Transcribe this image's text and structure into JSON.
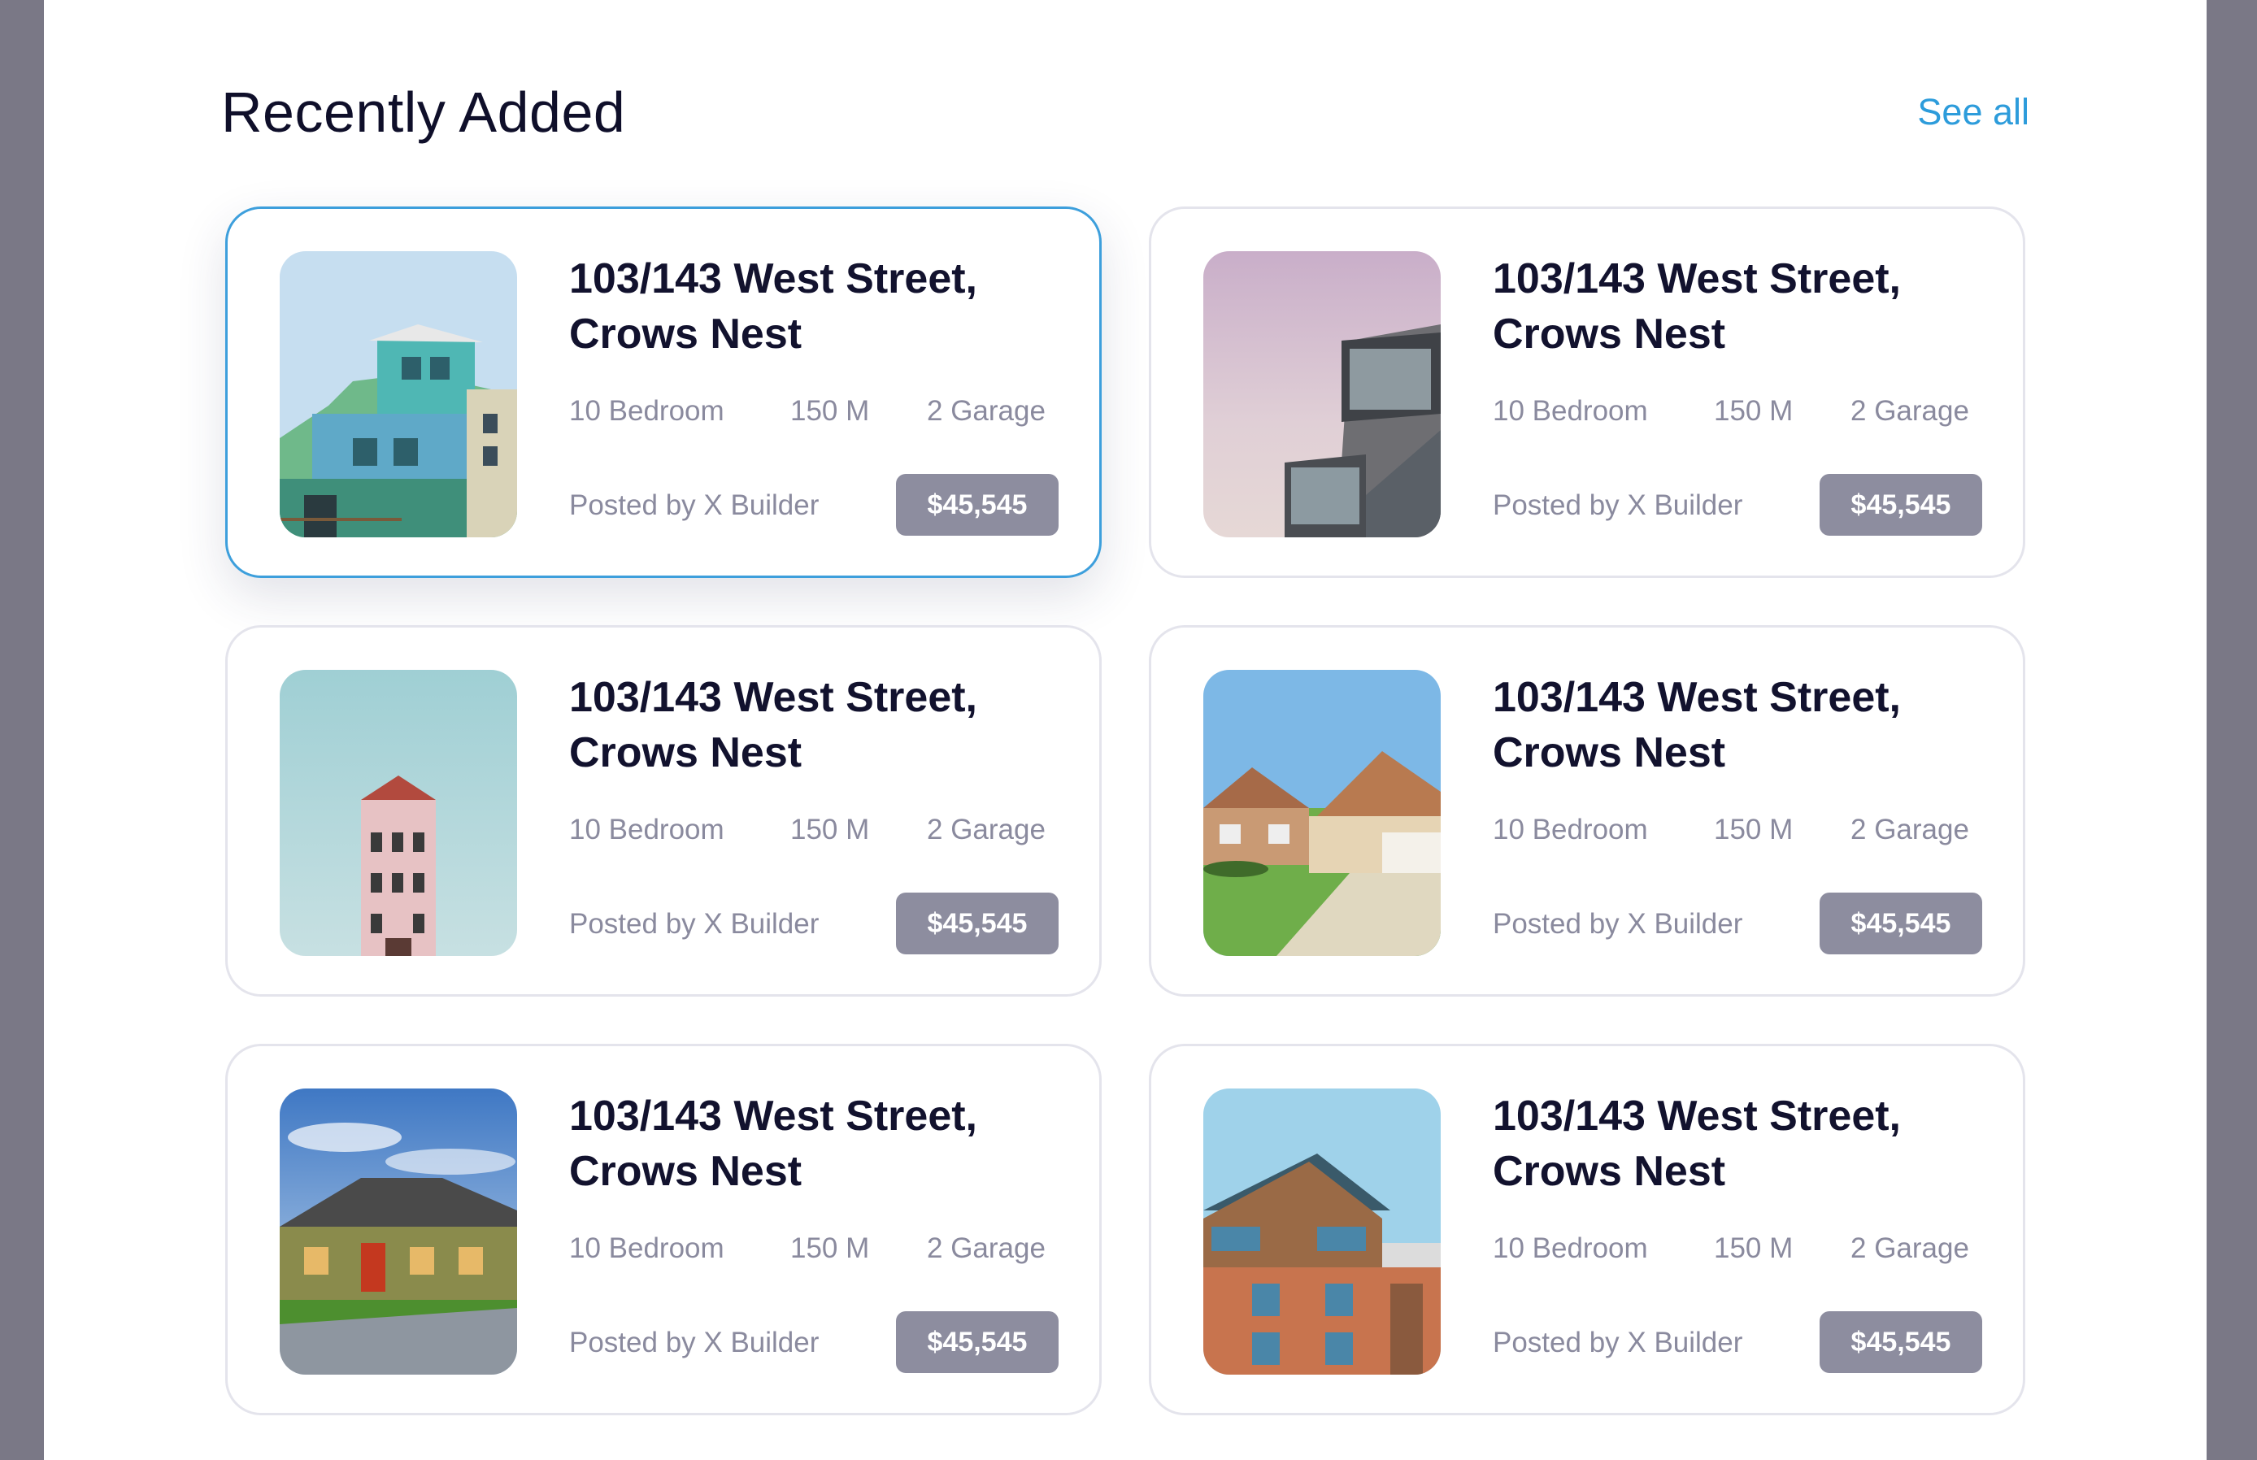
{
  "header": {
    "title": "Recently Added",
    "see_all": "See all"
  },
  "colors": {
    "accent": "#2d9cdb",
    "price_badge": "#8d8d9f",
    "title_text": "#12122e",
    "muted_text": "#8a8a9e"
  },
  "listings": [
    {
      "address": "103/143 West Street, Crows Nest",
      "bedrooms": "10 Bedroom",
      "area": "150 M",
      "garage": "2 Garage",
      "posted_by": "Posted by X Builder",
      "price": "$45,545",
      "image": "colorful-house-photo",
      "active": true
    },
    {
      "address": "103/143 West Street, Crows Nest",
      "bedrooms": "10 Bedroom",
      "area": "150 M",
      "garage": "2 Garage",
      "posted_by": "Posted by X Builder",
      "price": "$45,545",
      "image": "modern-glass-building-photo",
      "active": false
    },
    {
      "address": "103/143 West Street, Crows Nest",
      "bedrooms": "10 Bedroom",
      "area": "150 M",
      "garage": "2 Garage",
      "posted_by": "Posted by X Builder",
      "price": "$45,545",
      "image": "narrow-pink-tower-house-photo",
      "active": false
    },
    {
      "address": "103/143 West Street, Crows Nest",
      "bedrooms": "10 Bedroom",
      "area": "150 M",
      "garage": "2 Garage",
      "posted_by": "Posted by X Builder",
      "price": "$45,545",
      "image": "suburban-house-garage-photo",
      "active": false
    },
    {
      "address": "103/143 West Street, Crows Nest",
      "bedrooms": "10 Bedroom",
      "area": "150 M",
      "garage": "2 Garage",
      "posted_by": "Posted by X Builder",
      "price": "$45,545",
      "image": "green-house-lawn-photo",
      "active": false
    },
    {
      "address": "103/143 West Street, Crows Nest",
      "bedrooms": "10 Bedroom",
      "area": "150 M",
      "garage": "2 Garage",
      "posted_by": "Posted by X Builder",
      "price": "$45,545",
      "image": "brick-wood-apartment-photo",
      "active": false
    }
  ]
}
